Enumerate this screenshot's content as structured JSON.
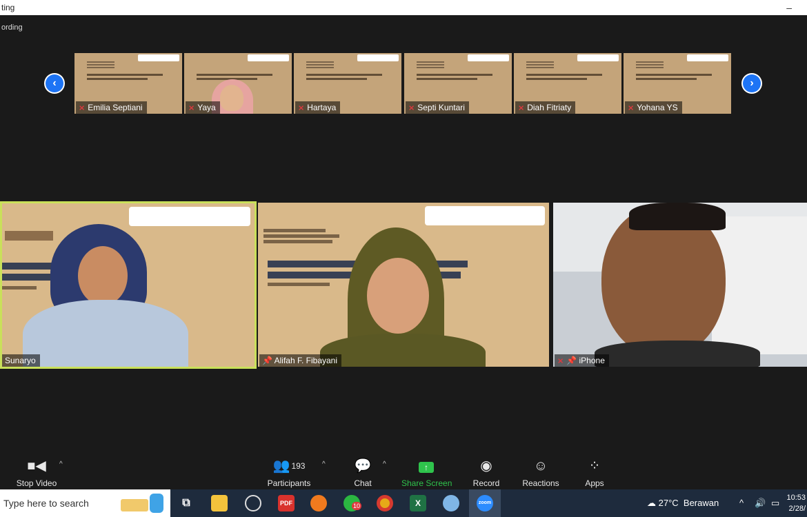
{
  "window": {
    "title": "ting",
    "minimize_symbol": "–"
  },
  "recording_label": "ording",
  "gallery": {
    "prev_icon": "‹",
    "next_icon": "›",
    "thumbnails": [
      {
        "name": "Emilia Septiani",
        "muted": true
      },
      {
        "name": "Yaya",
        "muted": true
      },
      {
        "name": "Hartaya",
        "muted": true
      },
      {
        "name": "Septi Kuntari",
        "muted": true
      },
      {
        "name": "Diah Fitriaty",
        "muted": true
      },
      {
        "name": "Yohana YS",
        "muted": true
      }
    ]
  },
  "main_tiles": [
    {
      "name": "Sunaryo",
      "active_speaker": true
    },
    {
      "name": "Alifah F. Fibayani",
      "pinned": true
    },
    {
      "name": "iPhone",
      "muted": true,
      "pinned": true
    }
  ],
  "toolbar": {
    "stop_video": "Stop Video",
    "participants": "Participants",
    "participants_count": "193",
    "chat": "Chat",
    "share_screen": "Share Screen",
    "record": "Record",
    "reactions": "Reactions",
    "apps": "Apps",
    "caret": "^"
  },
  "taskbar": {
    "search_placeholder": "Type here to search",
    "whatsapp_badge": "10",
    "weather_temp": "27°C",
    "weather_desc": "Berawan",
    "time": "10:53",
    "date": "2/28/"
  },
  "colors": {
    "active_speaker_border": "#c9e05a",
    "share_green": "#2fc34c",
    "nav_blue": "#1d74f5",
    "muted_red": "#e0393e"
  }
}
